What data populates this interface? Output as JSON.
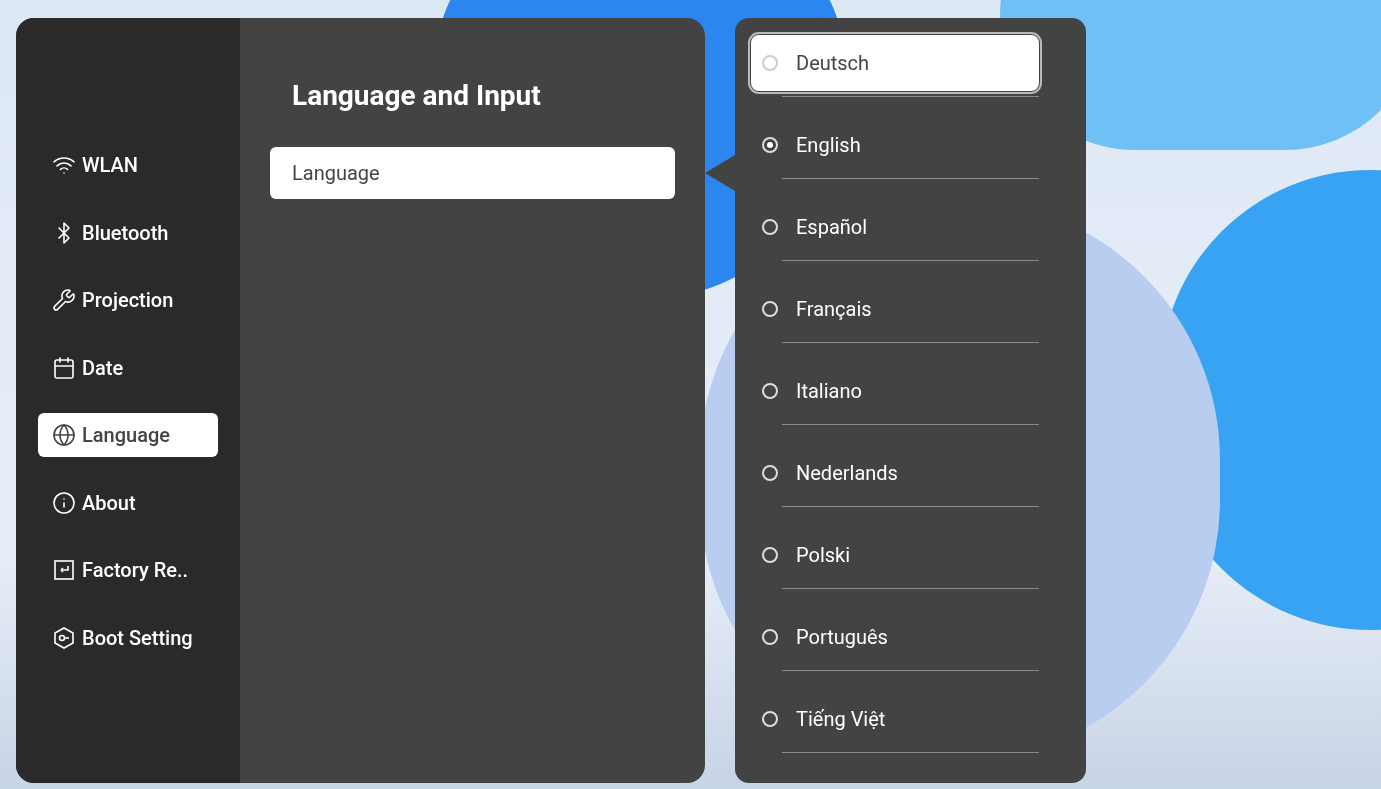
{
  "sidebar": {
    "items": [
      {
        "label": "WLAN",
        "selected": false
      },
      {
        "label": "Bluetooth",
        "selected": false
      },
      {
        "label": "Projection",
        "selected": false
      },
      {
        "label": "Date",
        "selected": false
      },
      {
        "label": "Language",
        "selected": true
      },
      {
        "label": "About",
        "selected": false
      },
      {
        "label": "Factory Re..",
        "selected": false
      },
      {
        "label": "Boot Setting",
        "selected": false
      }
    ]
  },
  "content": {
    "title": "Language and Input",
    "items": [
      {
        "label": "Language",
        "selected": true
      }
    ]
  },
  "language_options": [
    {
      "label": "Deutsch",
      "selected": false,
      "focused": true
    },
    {
      "label": "English",
      "selected": true,
      "focused": false
    },
    {
      "label": "Español",
      "selected": false,
      "focused": false
    },
    {
      "label": "Français",
      "selected": false,
      "focused": false
    },
    {
      "label": "Italiano",
      "selected": false,
      "focused": false
    },
    {
      "label": "Nederlands",
      "selected": false,
      "focused": false
    },
    {
      "label": "Polski",
      "selected": false,
      "focused": false
    },
    {
      "label": "Português",
      "selected": false,
      "focused": false
    },
    {
      "label": "Tiếng Việt",
      "selected": false,
      "focused": false
    }
  ]
}
